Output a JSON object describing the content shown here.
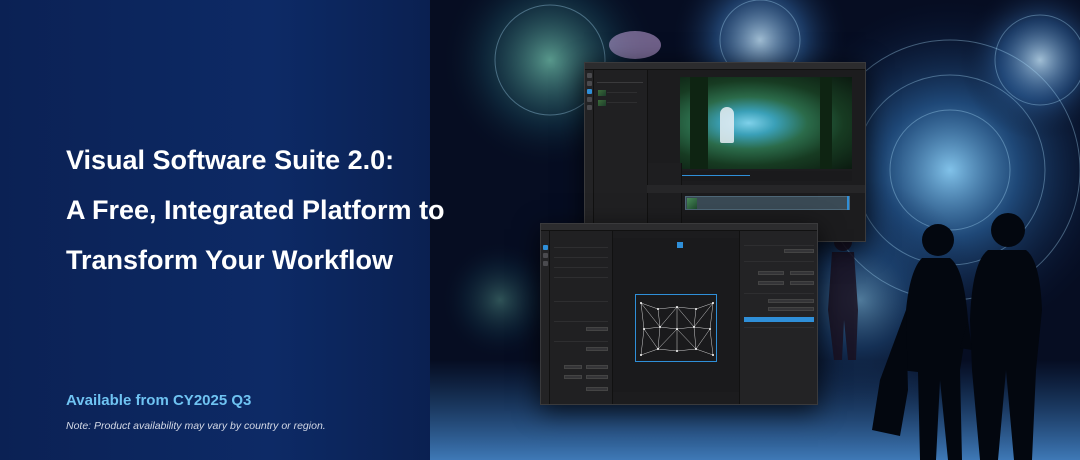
{
  "headline": {
    "line1": "Visual Software Suite 2.0:",
    "line2": "A Free, Integrated Platform to",
    "line3": "Transform Your Workflow"
  },
  "availability": "Available from CY2025 Q3",
  "note": "Note: Product availability may vary by country or region.",
  "colors": {
    "background_left": "#0b2154",
    "background_right": "#050b1c",
    "headline": "#ffffff",
    "availability": "#6fc3f2",
    "accent_blue": "#2f8fd8",
    "window_bg": "#1c1c1e"
  },
  "icons": [
    "app-window-screenshot",
    "mesh-warp-grid",
    "people-silhouette"
  ]
}
